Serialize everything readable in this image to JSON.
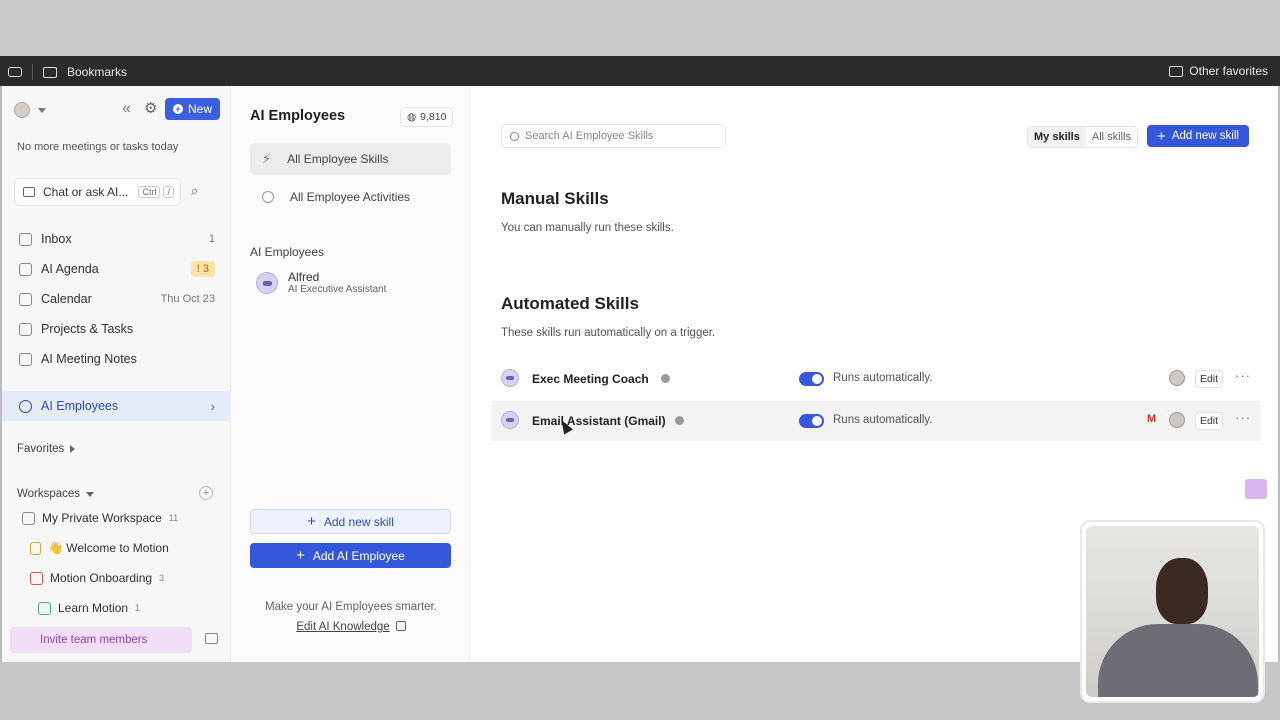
{
  "browser": {
    "bookmarks_label": "Bookmarks",
    "other_favorites_label": "Other favorites"
  },
  "sidebar": {
    "new_label": "New",
    "status": "No more meetings or tasks today",
    "chat_placeholder": "Chat or ask AI...",
    "chat_shortcut": [
      "Ctrl",
      "/"
    ],
    "nav": [
      {
        "label": "Inbox",
        "right": "1"
      },
      {
        "label": "AI Agenda",
        "badge": "3"
      },
      {
        "label": "Calendar",
        "right": "Thu Oct 23"
      },
      {
        "label": "Projects & Tasks"
      },
      {
        "label": "AI Meeting Notes"
      }
    ],
    "active_item": "AI Employees",
    "favorites_label": "Favorites",
    "workspaces_label": "Workspaces",
    "workspace_items": [
      {
        "label": "My Private Workspace",
        "count": "11"
      },
      {
        "label": "👋 Welcome to Motion"
      },
      {
        "label": "Motion Onboarding",
        "count": "3"
      },
      {
        "label": "Learn Motion",
        "count": "1"
      }
    ],
    "invite_label": "Invite team members"
  },
  "mid": {
    "title": "AI Employees",
    "credits": "9,810",
    "items": [
      "All Employee Skills",
      "All Employee Activities"
    ],
    "section_label": "AI Employees",
    "employee": {
      "name": "Alfred",
      "role": "AI Executive Assistant"
    },
    "add_skill_label": "Add new skill",
    "add_employee_label": "Add AI Employee",
    "smarter_text": "Make your AI Employees smarter.",
    "edit_knowledge_label": "Edit AI Knowledge"
  },
  "main": {
    "search_placeholder": "Search AI Employee Skills",
    "toggle": [
      "My skills",
      "All skills"
    ],
    "add_skill_label": "Add new skill",
    "manual_title": "Manual Skills",
    "manual_sub": "You can manually run these skills.",
    "auto_title": "Automated Skills",
    "auto_sub": "These skills run automatically on a trigger.",
    "skills": [
      {
        "name": "Exec Meeting Coach",
        "status": "Runs automatically.",
        "edit": "Edit"
      },
      {
        "name": "Email Assistant (Gmail)",
        "status": "Runs automatically.",
        "edit": "Edit",
        "gmail": "M"
      }
    ]
  },
  "colors": {
    "accent": "#3557db",
    "active_bg": "#e6ebf8",
    "badge": "#fde3a7",
    "invite": "#f0dff6"
  }
}
